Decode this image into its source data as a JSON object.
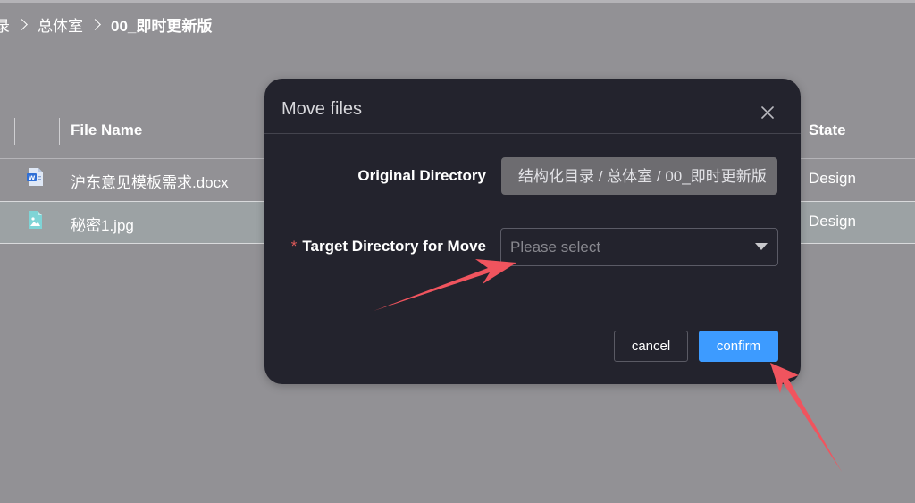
{
  "breadcrumb": {
    "items": [
      "录",
      "总体室",
      "00_即时更新版"
    ]
  },
  "table": {
    "columns": {
      "file_name": "File Name",
      "state": "State"
    },
    "rows": [
      {
        "icon": "word-doc-icon",
        "name": "沪东意见模板需求.docx",
        "state": "Design"
      },
      {
        "icon": "image-file-icon",
        "name": "秘密1.jpg",
        "state": "Design"
      }
    ]
  },
  "modal": {
    "title": "Move files",
    "original_label": "Original Directory",
    "original_value": "结构化目录 / 总体室 / 00_即时更新版",
    "target_required_mark": "*",
    "target_label": "Target Directory for Move",
    "target_placeholder": "Please select",
    "cancel_label": "cancel",
    "confirm_label": "confirm"
  },
  "colors": {
    "overlay": "#929195",
    "modal_bg": "#23232d",
    "primary": "#3d9bff",
    "annotation_arrow": "#f0545e",
    "required": "#e05a5a"
  }
}
